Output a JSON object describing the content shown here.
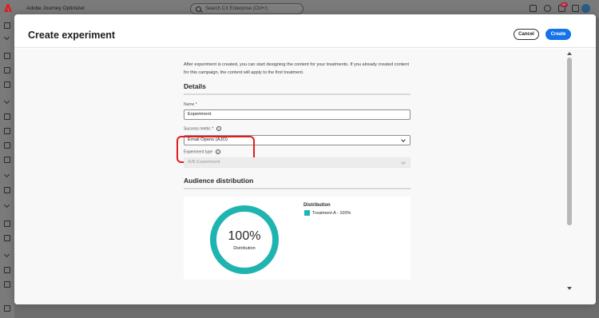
{
  "app": {
    "title": "Adobe Journey Optimizer",
    "search_placeholder": "Search CX Enterprise (Ctrl+/)",
    "notification_count": "9+"
  },
  "modal": {
    "title": "Create experiment",
    "cancel_label": "Cancel",
    "create_label": "Create",
    "intro_text": "After experiment is created, you can start designing the content for your treatments. If you already created content for this campaign, the content will apply to the first treatment.",
    "details": {
      "title": "Details",
      "name_label": "Name",
      "name_value": "Experiment",
      "success_metric_label": "Success metric",
      "success_metric_value": "Email Opens (AJO)",
      "experiment_type_label": "Experiment type",
      "experiment_type_value": "A/B Experiment",
      "required_marker": "*",
      "help_glyph": "?"
    },
    "audience": {
      "title": "Audience distribution",
      "donut_percent": "100%",
      "donut_label": "Distribution",
      "legend_title": "Distribution",
      "legend_item": "Treatment A - 100%"
    }
  },
  "colors": {
    "accent": "#1473e6",
    "treatment": "#20b4b0",
    "highlight": "#e11d1d",
    "brand": "#e11d1d"
  },
  "icons": [
    "adobe-logo-icon",
    "search-icon",
    "message-icon",
    "help-icon",
    "bell-icon",
    "apps-grid-icon",
    "home-icon",
    "chevron-down-icon"
  ]
}
